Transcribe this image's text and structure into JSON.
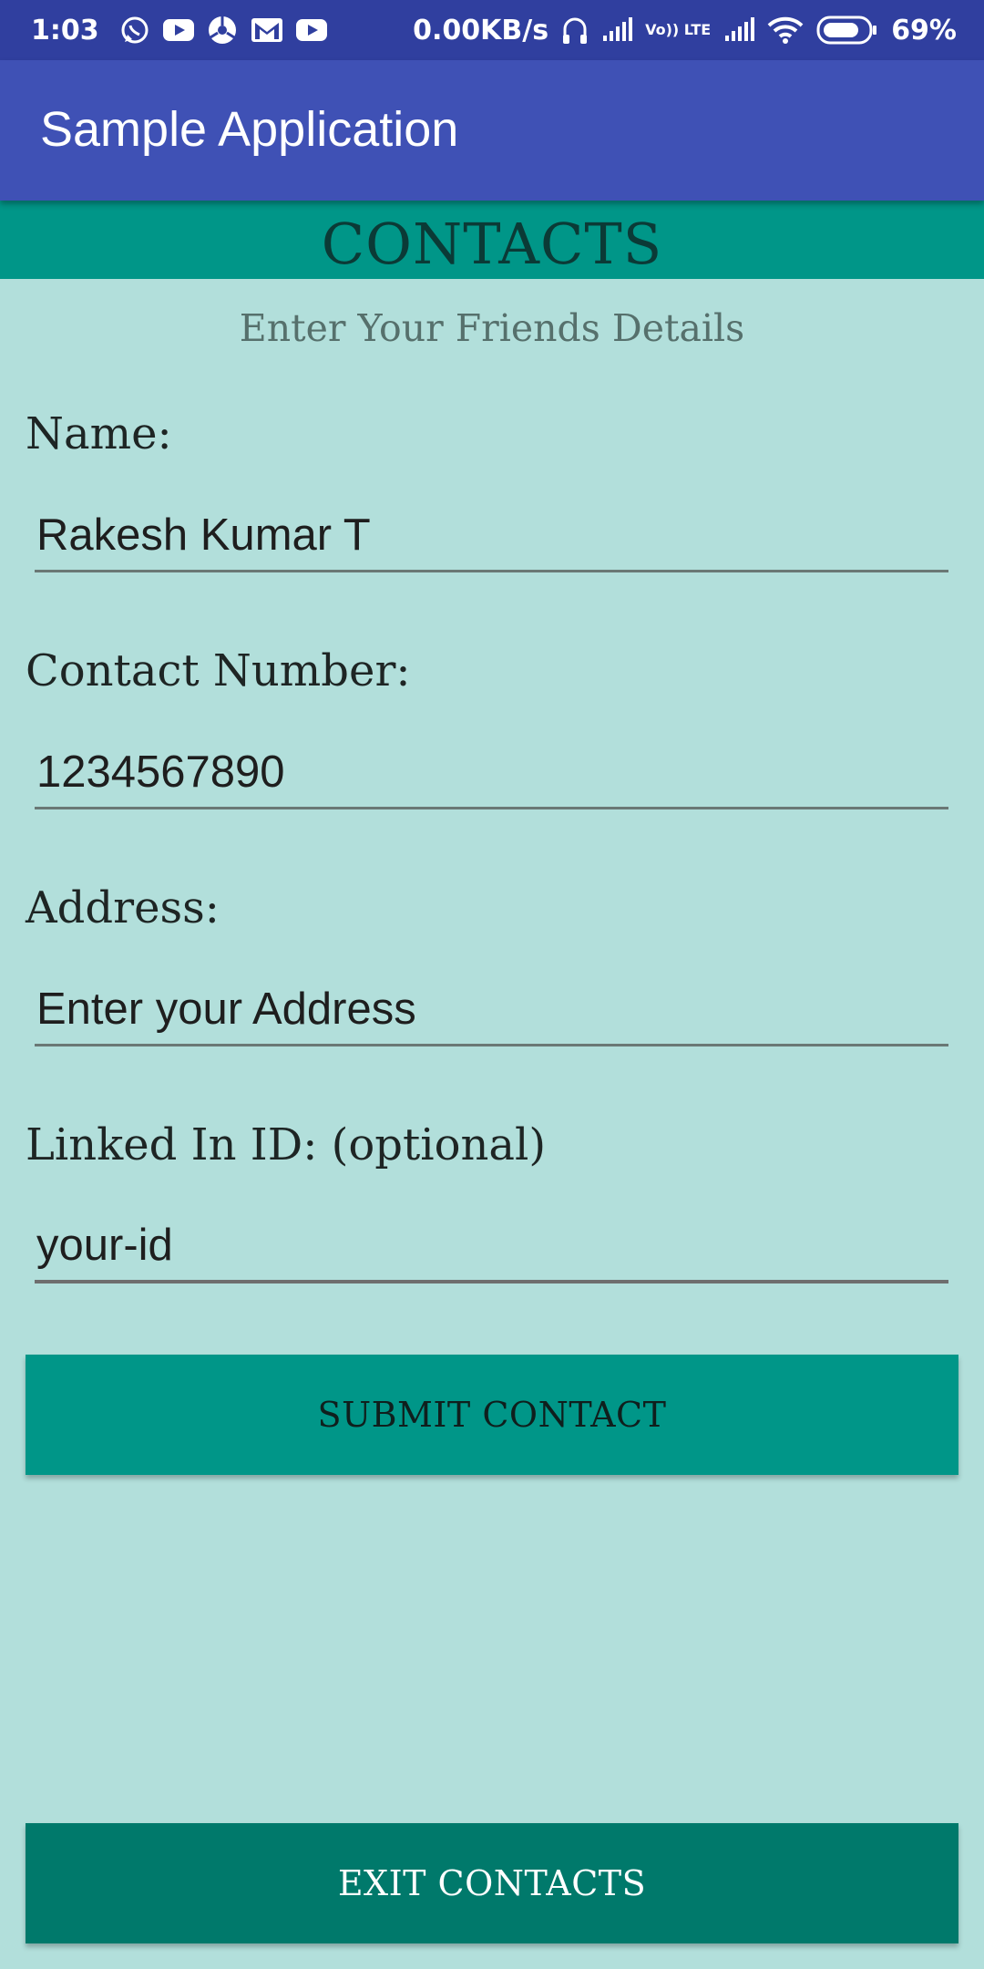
{
  "status_bar": {
    "time": "1:03",
    "network_speed": "0.00KB/s",
    "volte_text": "Vo)) LTE",
    "battery_percent": "69%",
    "notification_icons": [
      "whatsapp-icon",
      "youtube-icon",
      "chrome-icon",
      "gmail-icon",
      "youtube-icon"
    ],
    "system_icons": [
      "headphones-icon",
      "signal-icon",
      "volte-icon",
      "signal-icon",
      "wifi-icon",
      "battery-icon"
    ]
  },
  "app_bar": {
    "title": "Sample Application"
  },
  "header": {
    "title": "CONTACTS",
    "subtitle": "Enter Your Friends Details"
  },
  "form": {
    "name": {
      "label": "Name:",
      "value": "Rakesh Kumar T"
    },
    "contact_number": {
      "label": "Contact Number:",
      "value": "1234567890"
    },
    "address": {
      "label": "Address:",
      "placeholder": "Enter your Address"
    },
    "linkedin": {
      "label": "Linked In ID: (optional)",
      "placeholder": "your-id"
    }
  },
  "buttons": {
    "submit": "SUBMIT CONTACT",
    "exit": "EXIT CONTACTS"
  },
  "colors": {
    "status_bar": "#303f9f",
    "app_bar": "#3f51b5",
    "background": "#b2dfdb",
    "header": "#009688",
    "submit_button": "#009688",
    "exit_button": "#00796b"
  }
}
